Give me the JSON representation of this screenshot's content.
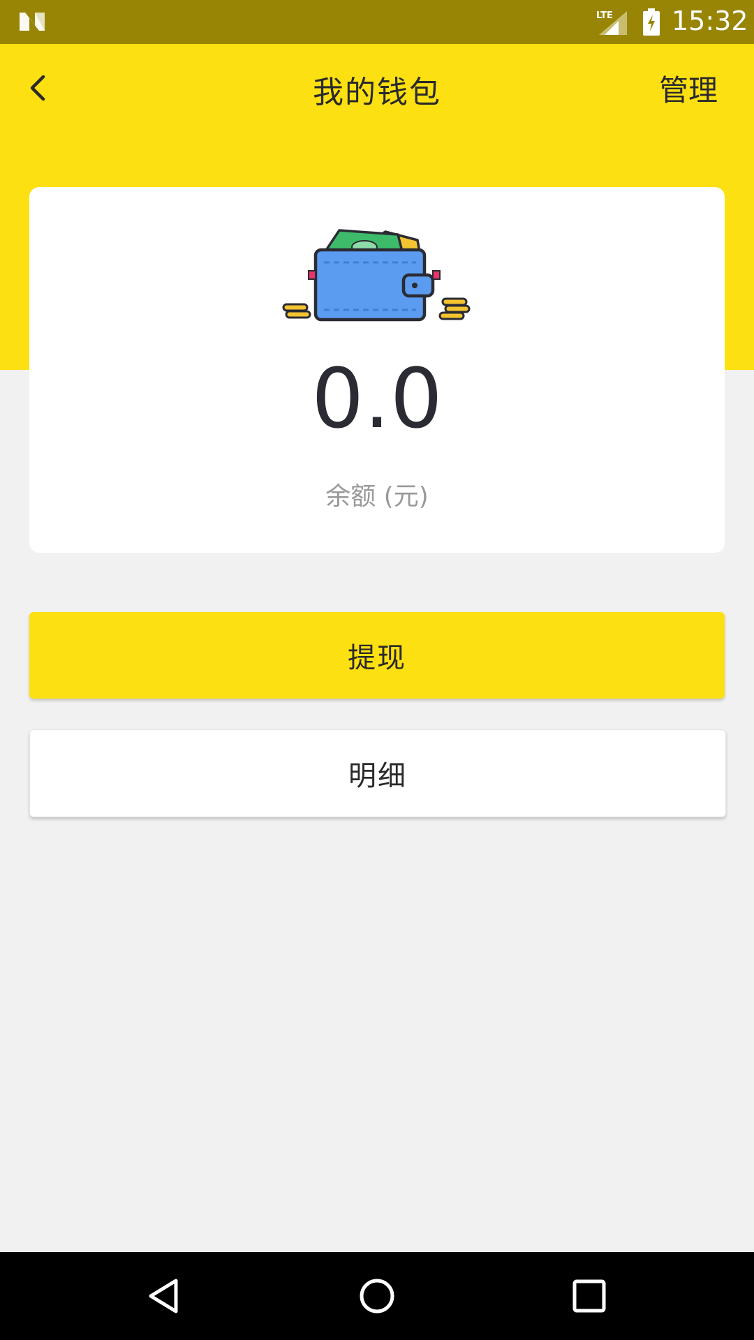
{
  "status_bar": {
    "time": "15:32",
    "network_label": "LTE",
    "icons": [
      "android-n-icon",
      "lte-signal-icon",
      "battery-charging-icon"
    ]
  },
  "header": {
    "back_icon": "chevron-left-icon",
    "title": "我的钱包",
    "manage_label": "管理",
    "color": "#fde011"
  },
  "balance_card": {
    "illustration": "wallet-icon",
    "amount": "0.0",
    "label": "余额 (元)"
  },
  "actions": {
    "withdraw_label": "提现",
    "details_label": "明细"
  },
  "nav_bar": {
    "icons": [
      "back-triangle-icon",
      "home-circle-icon",
      "recents-square-icon"
    ]
  }
}
